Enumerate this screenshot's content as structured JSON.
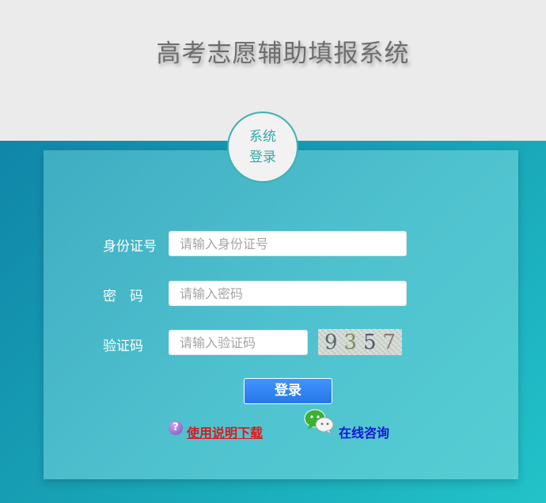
{
  "header": {
    "title": "高考志愿辅助填报系统"
  },
  "badge": {
    "line1": "系统",
    "line2": "登录"
  },
  "form": {
    "id_label": "身份证号",
    "id_placeholder": "请输入身份证号",
    "password_label": "密　码",
    "password_placeholder": "请输入密码",
    "captcha_label": "验证码",
    "captcha_placeholder": "请输入验证码",
    "captcha_digits": [
      "9",
      "3",
      "5",
      "7"
    ],
    "login_label": "登录"
  },
  "links": {
    "manual_label": "使用说明下载",
    "consult_label": "在线咨询"
  },
  "icons": {
    "help": "question-circle-icon",
    "wechat": "wechat-icon"
  },
  "colors": {
    "accent": "#2f86f5",
    "manual_link": "#e0161b",
    "consult_link": "#1515d6",
    "badge_text": "#3aa9a6"
  }
}
